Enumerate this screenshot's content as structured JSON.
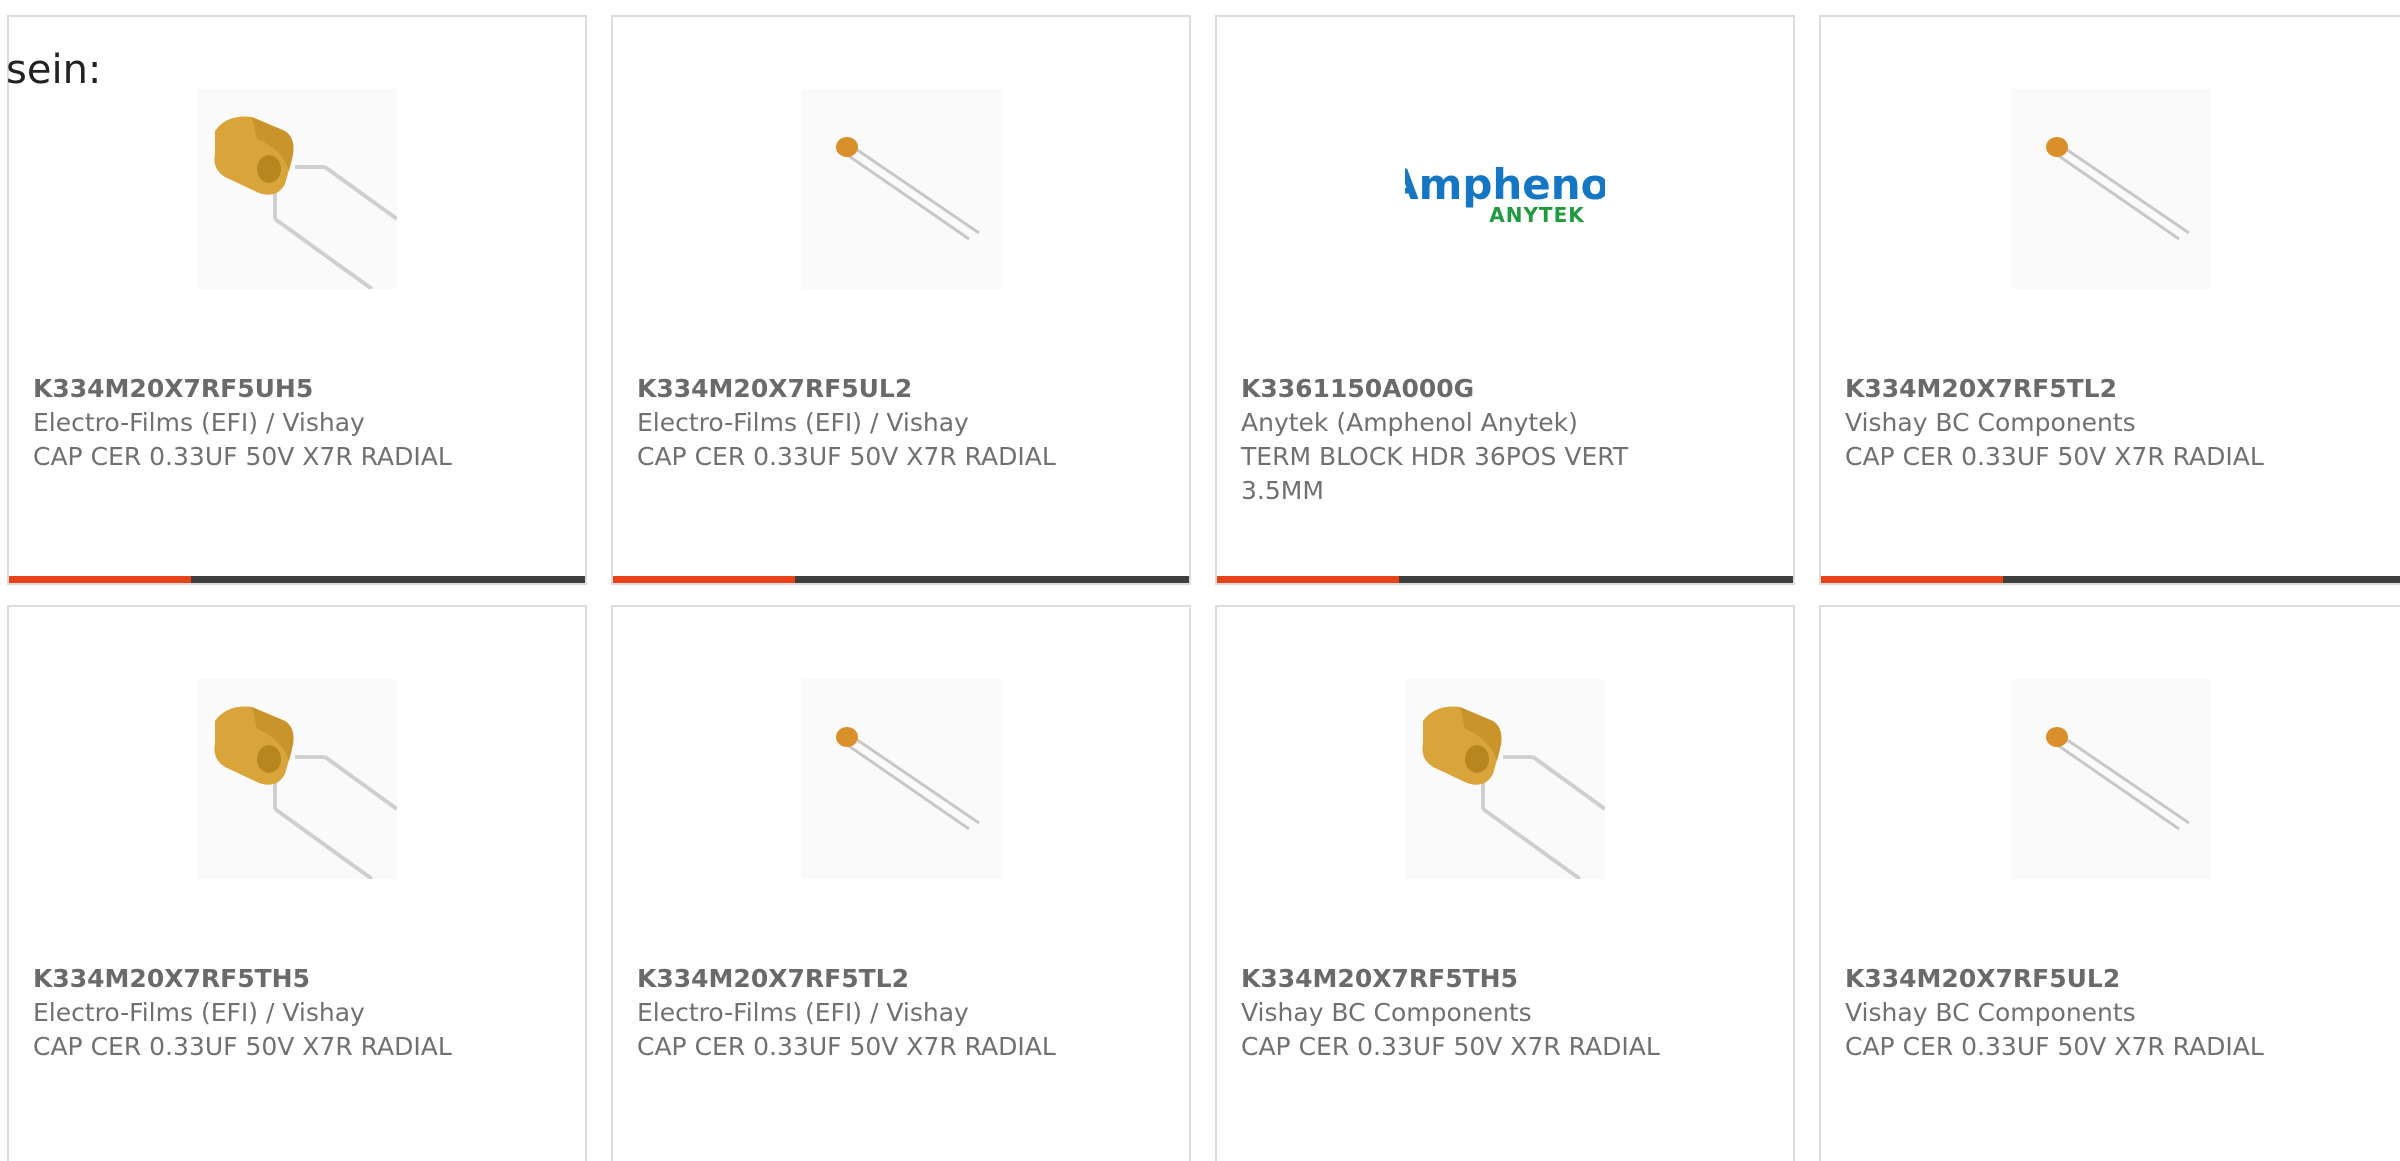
{
  "intro": {
    "text": "sein:"
  },
  "colors": {
    "accent": "#e8421b",
    "bar": "#3f3f3f",
    "text": "#707070",
    "border": "#dcdcdc"
  },
  "products": [
    {
      "part": "K334M20X7RF5UH5",
      "manufacturer": "Electro-Films (EFI) / Vishay",
      "description": "CAP CER 0.33UF 50V X7R RADIAL",
      "image": "capacitor-large-icon"
    },
    {
      "part": "K334M20X7RF5UL2",
      "manufacturer": "Electro-Films (EFI) / Vishay",
      "description": "CAP CER 0.33UF 50V X7R RADIAL",
      "image": "capacitor-small-icon"
    },
    {
      "part": "K3361150A000G",
      "manufacturer": "Anytek (Amphenol Anytek)",
      "description": "TERM BLOCK HDR 36POS VERT 3.5MM",
      "image": "amphenol-anytek-logo",
      "logo_line1": "Amphenol",
      "logo_line2": "ANYTEK"
    },
    {
      "part": "K334M20X7RF5TL2",
      "manufacturer": "Vishay BC Components",
      "description": "CAP CER 0.33UF 50V X7R RADIAL",
      "image": "capacitor-small-icon"
    },
    {
      "part": "K334M20X7RF5TH5",
      "manufacturer": "Electro-Films (EFI) / Vishay",
      "description": "CAP CER 0.33UF 50V X7R RADIAL",
      "image": "capacitor-large-icon"
    },
    {
      "part": "K334M20X7RF5TL2",
      "manufacturer": "Electro-Films (EFI) / Vishay",
      "description": "CAP CER 0.33UF 50V X7R RADIAL",
      "image": "capacitor-small-icon"
    },
    {
      "part": "K334M20X7RF5TH5",
      "manufacturer": "Vishay BC Components",
      "description": "CAP CER 0.33UF 50V X7R RADIAL",
      "image": "capacitor-large-icon"
    },
    {
      "part": "K334M20X7RF5UL2",
      "manufacturer": "Vishay BC Components",
      "description": "CAP CER 0.33UF 50V X7R RADIAL",
      "image": "capacitor-small-icon"
    }
  ]
}
